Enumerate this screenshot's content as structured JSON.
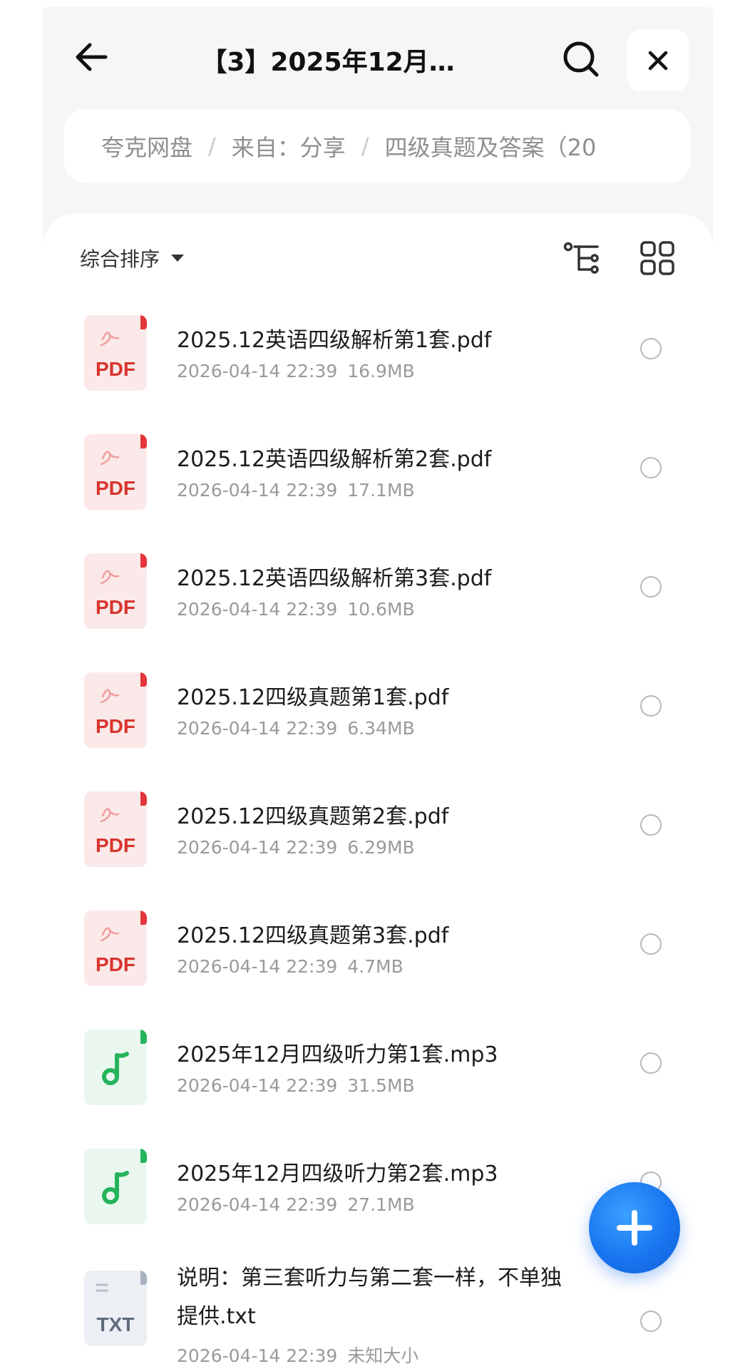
{
  "header": {
    "title": "【3】2025年12月…",
    "back_icon": "arrow-left-icon",
    "search_icon": "search-icon",
    "close_icon": "close-icon"
  },
  "breadcrumb": [
    "夸克网盘",
    "来自：分享",
    "四级真题及答案（20"
  ],
  "toolbar": {
    "sort_label": "综合排序",
    "sort_icon": "caret-down-icon",
    "tree_icon": "tree-view-icon",
    "grid_icon": "grid-view-icon"
  },
  "files": [
    {
      "name": "2025.12英语四级解析第1套.pdf",
      "date": "2026-04-14 22:39",
      "size": "16.9MB",
      "type": "pdf",
      "label": "PDF"
    },
    {
      "name": "2025.12英语四级解析第2套.pdf",
      "date": "2026-04-14 22:39",
      "size": "17.1MB",
      "type": "pdf",
      "label": "PDF"
    },
    {
      "name": "2025.12英语四级解析第3套.pdf",
      "date": "2026-04-14 22:39",
      "size": "10.6MB",
      "type": "pdf",
      "label": "PDF"
    },
    {
      "name": "2025.12四级真题第1套.pdf",
      "date": "2026-04-14 22:39",
      "size": "6.34MB",
      "type": "pdf",
      "label": "PDF"
    },
    {
      "name": "2025.12四级真题第2套.pdf",
      "date": "2026-04-14 22:39",
      "size": "6.29MB",
      "type": "pdf",
      "label": "PDF"
    },
    {
      "name": "2025.12四级真题第3套.pdf",
      "date": "2026-04-14 22:39",
      "size": "4.7MB",
      "type": "pdf",
      "label": "PDF"
    },
    {
      "name": "2025年12月四级听力第1套.mp3",
      "date": "2026-04-14 22:39",
      "size": "31.5MB",
      "type": "mp3",
      "label": ""
    },
    {
      "name": "2025年12月四级听力第2套.mp3",
      "date": "2026-04-14 22:39",
      "size": "27.1MB",
      "type": "mp3",
      "label": ""
    },
    {
      "name": "说明：第三套听力与第二套一样，不单独提供.txt",
      "date": "2026-04-14 22:39",
      "size": "未知大小",
      "type": "txt",
      "label": "TXT"
    }
  ],
  "fab_icon": "plus-icon",
  "colors": {
    "accent": "#1976f0",
    "pdf": "#d9342e",
    "mp3": "#25b35c",
    "txt": "#5f6b7d"
  }
}
